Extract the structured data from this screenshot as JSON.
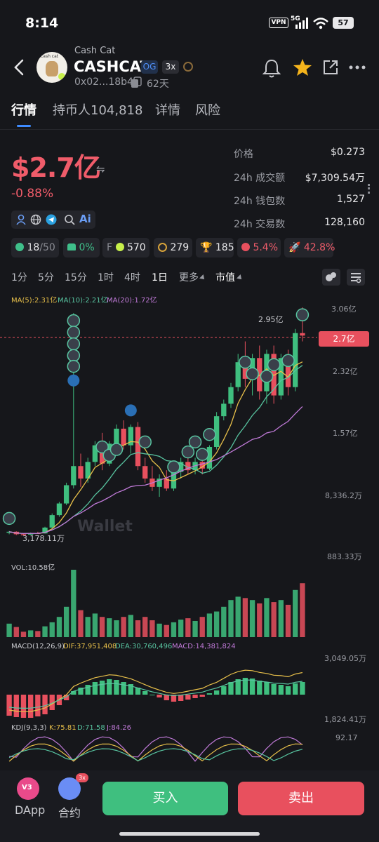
{
  "status_bar": {
    "time": "8:14",
    "vpn": "VPN",
    "network": "5G",
    "battery": "57"
  },
  "header": {
    "back_icon": "chevron-left-icon",
    "subtitle": "Cash Cat",
    "title": "CASHCAT",
    "badge_og": "OG",
    "badge_leverage": "3x",
    "address": "0x02...18b4",
    "age": "62天",
    "avatar_text": "cash cat"
  },
  "tabs": [
    "行情",
    "持币人104,818",
    "详情",
    "风险"
  ],
  "price": {
    "market_cap": "$2.7亿",
    "swap_icon": "⇋",
    "change": "-0.88%"
  },
  "stats": [
    {
      "label": "价格",
      "value": "$0.273"
    },
    {
      "label": "24h 成交额",
      "value": "$7,309.54万"
    },
    {
      "label": "24h 钱包数",
      "value": "1,527"
    },
    {
      "label": "24h 交易数",
      "value": "128,160"
    }
  ],
  "chips": {
    "holders_ratio": "18",
    "holders_total": "/50",
    "top_pct": "0%",
    "f_label": "F",
    "f_value": "570",
    "fee_value": "279",
    "trophy_value": "185",
    "risk_pct": "5.4%",
    "rocket_pct": "42.8%"
  },
  "timeframes": [
    "1分",
    "5分",
    "15分",
    "1时",
    "4时",
    "1日",
    "更多",
    "市值"
  ],
  "indicators": {
    "ma5": "MA(5):2.31亿",
    "ma10": "MA(10):2.21亿",
    "ma20": "MA(20):1.72亿",
    "vol": "VOL:10.58亿",
    "macd_title": "MACD(12,26,9)",
    "dif": "DIF:37,951,408",
    "dea": "DEA:30,760,496",
    "macd_val": "MACD:14,381,824",
    "kdj_title": "KDJ(9,3,3)",
    "k": "K:75.81",
    "d": "D:71.58",
    "j": "J:84.26"
  },
  "chart_axis": {
    "y_ticks": [
      "3.06亿",
      "2.32亿",
      "1.57亿",
      "8,336.2万",
      "883.33万"
    ],
    "current": "2.7亿",
    "high_label": "2.95亿",
    "low_label": "3,178.11万",
    "macd_ticks": [
      "3,049.05万",
      "1,824.41万"
    ],
    "kdj_tick": "92.17",
    "watermark": "Wallet"
  },
  "chart_data": {
    "type": "candlestick",
    "candles": [
      [
        3500,
        3700,
        3300,
        3600
      ],
      [
        3600,
        3650,
        3200,
        3300
      ],
      [
        3300,
        3400,
        3178,
        3250
      ],
      [
        3250,
        3500,
        3200,
        3450
      ],
      [
        3450,
        3600,
        3350,
        3400
      ],
      [
        3400,
        4200,
        3380,
        4100
      ],
      [
        4100,
        5800,
        4000,
        5600
      ],
      [
        5600,
        7200,
        5400,
        7000
      ],
      [
        7000,
        9500,
        6800,
        9200
      ],
      [
        9200,
        29900,
        8800,
        11500
      ],
      [
        11500,
        13000,
        9000,
        10000
      ],
      [
        10000,
        12500,
        9500,
        12000
      ],
      [
        12000,
        14500,
        11500,
        14000
      ],
      [
        14000,
        15500,
        11000,
        11800
      ],
      [
        11800,
        14500,
        11500,
        14200
      ],
      [
        14200,
        16500,
        13500,
        16000
      ],
      [
        16000,
        17000,
        13500,
        14000
      ],
      [
        14000,
        16500,
        13000,
        16200
      ],
      [
        16200,
        16800,
        11000,
        11500
      ],
      [
        11500,
        12500,
        9500,
        10000
      ],
      [
        10000,
        11500,
        8500,
        9000
      ],
      [
        9000,
        10500,
        7800,
        10000
      ],
      [
        10000,
        11000,
        8500,
        8800
      ],
      [
        8800,
        11000,
        8500,
        10800
      ],
      [
        10800,
        12500,
        10000,
        12000
      ],
      [
        12000,
        13000,
        10500,
        11000
      ],
      [
        11000,
        12500,
        10500,
        12000
      ],
      [
        12000,
        12500,
        10500,
        11200
      ],
      [
        11200,
        14000,
        11000,
        13800
      ],
      [
        13800,
        18000,
        13500,
        17500
      ],
      [
        17500,
        19500,
        17000,
        19000
      ],
      [
        19000,
        21500,
        18500,
        21000
      ],
      [
        21000,
        25000,
        20500,
        24000
      ],
      [
        24000,
        26500,
        21000,
        22000
      ],
      [
        22000,
        25000,
        20000,
        24500
      ],
      [
        24500,
        26000,
        19500,
        20500
      ],
      [
        20500,
        25500,
        19000,
        25000
      ],
      [
        25000,
        26000,
        19000,
        20000
      ],
      [
        20000,
        25000,
        19500,
        24500
      ],
      [
        24500,
        25500,
        20000,
        21000
      ],
      [
        21000,
        28000,
        20500,
        27500
      ],
      [
        27500,
        30600,
        26500,
        27200
      ]
    ],
    "volume": [
      20,
      15,
      8,
      10,
      9,
      16,
      22,
      30,
      45,
      100,
      40,
      30,
      35,
      30,
      28,
      25,
      30,
      33,
      25,
      30,
      25,
      20,
      18,
      22,
      26,
      28,
      24,
      30,
      35,
      38,
      45,
      55,
      60,
      58,
      55,
      50,
      58,
      52,
      55,
      48,
      70,
      80
    ],
    "macd_hist": [
      -30,
      -32,
      -33,
      -33,
      -31,
      -28,
      -22,
      -15,
      -8,
      5,
      10,
      14,
      18,
      20,
      22,
      21,
      18,
      15,
      10,
      5,
      0,
      -4,
      -8,
      -10,
      -9,
      -7,
      -5,
      -3,
      2,
      6,
      12,
      18,
      22,
      24,
      23,
      20,
      18,
      15,
      14,
      12,
      16,
      18
    ],
    "ylim": [
      883.33,
      30600
    ]
  }
}
